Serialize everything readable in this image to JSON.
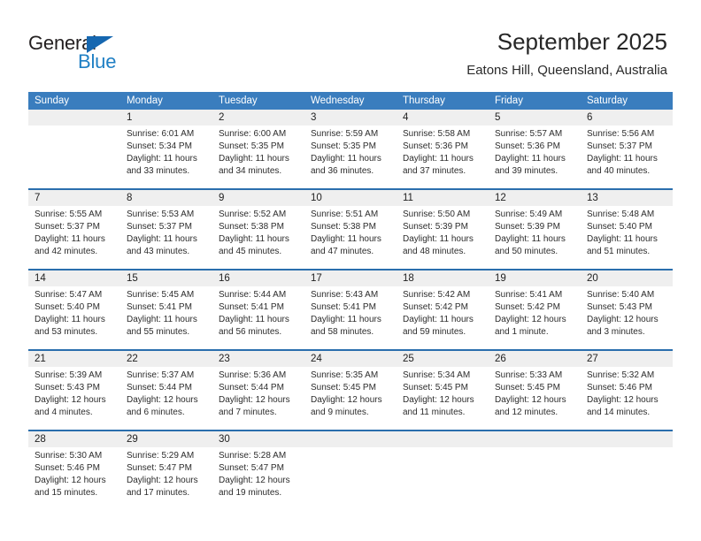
{
  "brand": {
    "name_top": "General",
    "name_bottom": "Blue",
    "accent_color": "#1f7fc4",
    "triangle_color": "#1667b0"
  },
  "header": {
    "title": "September 2025",
    "subtitle": "Eatons Hill, Queensland, Australia"
  },
  "calendar": {
    "header_bg": "#3a7dbe",
    "row_divider_color": "#2a6ead",
    "daynum_bg": "#efefef",
    "weekdays": [
      "Sunday",
      "Monday",
      "Tuesday",
      "Wednesday",
      "Thursday",
      "Friday",
      "Saturday"
    ],
    "weeks": [
      [
        {
          "date": "",
          "sunrise": "",
          "sunset": "",
          "daylight1": "",
          "daylight2": ""
        },
        {
          "date": "1",
          "sunrise": "Sunrise: 6:01 AM",
          "sunset": "Sunset: 5:34 PM",
          "daylight1": "Daylight: 11 hours",
          "daylight2": "and 33 minutes."
        },
        {
          "date": "2",
          "sunrise": "Sunrise: 6:00 AM",
          "sunset": "Sunset: 5:35 PM",
          "daylight1": "Daylight: 11 hours",
          "daylight2": "and 34 minutes."
        },
        {
          "date": "3",
          "sunrise": "Sunrise: 5:59 AM",
          "sunset": "Sunset: 5:35 PM",
          "daylight1": "Daylight: 11 hours",
          "daylight2": "and 36 minutes."
        },
        {
          "date": "4",
          "sunrise": "Sunrise: 5:58 AM",
          "sunset": "Sunset: 5:36 PM",
          "daylight1": "Daylight: 11 hours",
          "daylight2": "and 37 minutes."
        },
        {
          "date": "5",
          "sunrise": "Sunrise: 5:57 AM",
          "sunset": "Sunset: 5:36 PM",
          "daylight1": "Daylight: 11 hours",
          "daylight2": "and 39 minutes."
        },
        {
          "date": "6",
          "sunrise": "Sunrise: 5:56 AM",
          "sunset": "Sunset: 5:37 PM",
          "daylight1": "Daylight: 11 hours",
          "daylight2": "and 40 minutes."
        }
      ],
      [
        {
          "date": "7",
          "sunrise": "Sunrise: 5:55 AM",
          "sunset": "Sunset: 5:37 PM",
          "daylight1": "Daylight: 11 hours",
          "daylight2": "and 42 minutes."
        },
        {
          "date": "8",
          "sunrise": "Sunrise: 5:53 AM",
          "sunset": "Sunset: 5:37 PM",
          "daylight1": "Daylight: 11 hours",
          "daylight2": "and 43 minutes."
        },
        {
          "date": "9",
          "sunrise": "Sunrise: 5:52 AM",
          "sunset": "Sunset: 5:38 PM",
          "daylight1": "Daylight: 11 hours",
          "daylight2": "and 45 minutes."
        },
        {
          "date": "10",
          "sunrise": "Sunrise: 5:51 AM",
          "sunset": "Sunset: 5:38 PM",
          "daylight1": "Daylight: 11 hours",
          "daylight2": "and 47 minutes."
        },
        {
          "date": "11",
          "sunrise": "Sunrise: 5:50 AM",
          "sunset": "Sunset: 5:39 PM",
          "daylight1": "Daylight: 11 hours",
          "daylight2": "and 48 minutes."
        },
        {
          "date": "12",
          "sunrise": "Sunrise: 5:49 AM",
          "sunset": "Sunset: 5:39 PM",
          "daylight1": "Daylight: 11 hours",
          "daylight2": "and 50 minutes."
        },
        {
          "date": "13",
          "sunrise": "Sunrise: 5:48 AM",
          "sunset": "Sunset: 5:40 PM",
          "daylight1": "Daylight: 11 hours",
          "daylight2": "and 51 minutes."
        }
      ],
      [
        {
          "date": "14",
          "sunrise": "Sunrise: 5:47 AM",
          "sunset": "Sunset: 5:40 PM",
          "daylight1": "Daylight: 11 hours",
          "daylight2": "and 53 minutes."
        },
        {
          "date": "15",
          "sunrise": "Sunrise: 5:45 AM",
          "sunset": "Sunset: 5:41 PM",
          "daylight1": "Daylight: 11 hours",
          "daylight2": "and 55 minutes."
        },
        {
          "date": "16",
          "sunrise": "Sunrise: 5:44 AM",
          "sunset": "Sunset: 5:41 PM",
          "daylight1": "Daylight: 11 hours",
          "daylight2": "and 56 minutes."
        },
        {
          "date": "17",
          "sunrise": "Sunrise: 5:43 AM",
          "sunset": "Sunset: 5:41 PM",
          "daylight1": "Daylight: 11 hours",
          "daylight2": "and 58 minutes."
        },
        {
          "date": "18",
          "sunrise": "Sunrise: 5:42 AM",
          "sunset": "Sunset: 5:42 PM",
          "daylight1": "Daylight: 11 hours",
          "daylight2": "and 59 minutes."
        },
        {
          "date": "19",
          "sunrise": "Sunrise: 5:41 AM",
          "sunset": "Sunset: 5:42 PM",
          "daylight1": "Daylight: 12 hours",
          "daylight2": "and 1 minute."
        },
        {
          "date": "20",
          "sunrise": "Sunrise: 5:40 AM",
          "sunset": "Sunset: 5:43 PM",
          "daylight1": "Daylight: 12 hours",
          "daylight2": "and 3 minutes."
        }
      ],
      [
        {
          "date": "21",
          "sunrise": "Sunrise: 5:39 AM",
          "sunset": "Sunset: 5:43 PM",
          "daylight1": "Daylight: 12 hours",
          "daylight2": "and 4 minutes."
        },
        {
          "date": "22",
          "sunrise": "Sunrise: 5:37 AM",
          "sunset": "Sunset: 5:44 PM",
          "daylight1": "Daylight: 12 hours",
          "daylight2": "and 6 minutes."
        },
        {
          "date": "23",
          "sunrise": "Sunrise: 5:36 AM",
          "sunset": "Sunset: 5:44 PM",
          "daylight1": "Daylight: 12 hours",
          "daylight2": "and 7 minutes."
        },
        {
          "date": "24",
          "sunrise": "Sunrise: 5:35 AM",
          "sunset": "Sunset: 5:45 PM",
          "daylight1": "Daylight: 12 hours",
          "daylight2": "and 9 minutes."
        },
        {
          "date": "25",
          "sunrise": "Sunrise: 5:34 AM",
          "sunset": "Sunset: 5:45 PM",
          "daylight1": "Daylight: 12 hours",
          "daylight2": "and 11 minutes."
        },
        {
          "date": "26",
          "sunrise": "Sunrise: 5:33 AM",
          "sunset": "Sunset: 5:45 PM",
          "daylight1": "Daylight: 12 hours",
          "daylight2": "and 12 minutes."
        },
        {
          "date": "27",
          "sunrise": "Sunrise: 5:32 AM",
          "sunset": "Sunset: 5:46 PM",
          "daylight1": "Daylight: 12 hours",
          "daylight2": "and 14 minutes."
        }
      ],
      [
        {
          "date": "28",
          "sunrise": "Sunrise: 5:30 AM",
          "sunset": "Sunset: 5:46 PM",
          "daylight1": "Daylight: 12 hours",
          "daylight2": "and 15 minutes."
        },
        {
          "date": "29",
          "sunrise": "Sunrise: 5:29 AM",
          "sunset": "Sunset: 5:47 PM",
          "daylight1": "Daylight: 12 hours",
          "daylight2": "and 17 minutes."
        },
        {
          "date": "30",
          "sunrise": "Sunrise: 5:28 AM",
          "sunset": "Sunset: 5:47 PM",
          "daylight1": "Daylight: 12 hours",
          "daylight2": "and 19 minutes."
        },
        {
          "date": "",
          "sunrise": "",
          "sunset": "",
          "daylight1": "",
          "daylight2": ""
        },
        {
          "date": "",
          "sunrise": "",
          "sunset": "",
          "daylight1": "",
          "daylight2": ""
        },
        {
          "date": "",
          "sunrise": "",
          "sunset": "",
          "daylight1": "",
          "daylight2": ""
        },
        {
          "date": "",
          "sunrise": "",
          "sunset": "",
          "daylight1": "",
          "daylight2": ""
        }
      ]
    ]
  }
}
